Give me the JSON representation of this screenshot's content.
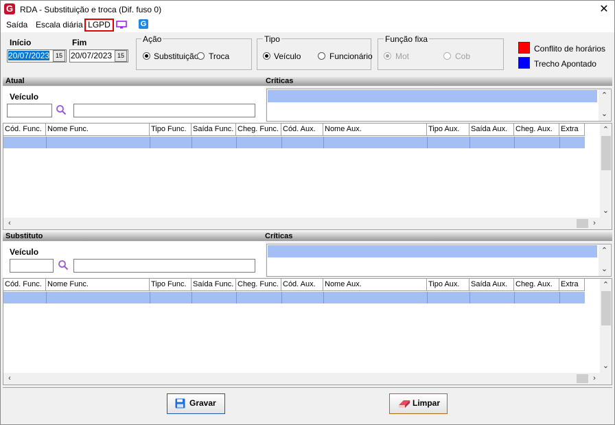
{
  "window": {
    "title": "RDA - Substituição e troca (Dif. fuso 0)"
  },
  "menu": {
    "saida": "Saída",
    "escala": "Escala diária",
    "lgpd": "LGPD"
  },
  "dates": {
    "inicio_label": "Início",
    "inicio_value": "20/07/2023",
    "fim_label": "Fim",
    "fim_value": "20/07/2023",
    "cal_glyph": "15"
  },
  "acao": {
    "title": "Ação",
    "opt1": "Substituição",
    "opt2": "Troca",
    "selected": "Substituição"
  },
  "tipo": {
    "title": "Tipo",
    "opt1": "Veículo",
    "opt2": "Funcionário",
    "selected": "Veículo"
  },
  "funcao": {
    "title": "Função fixa",
    "opt1": "Mot",
    "opt2": "Cob",
    "selected": "Mot"
  },
  "legend": {
    "conflito": "Conflito de horários",
    "conflito_color": "#ff0000",
    "trecho": "Trecho Apontado",
    "trecho_color": "#0000ff"
  },
  "atual": {
    "header": "Atual",
    "criticas": "Críticas",
    "veiculo_label": "Veículo"
  },
  "substituto": {
    "header": "Substituto",
    "criticas": "Críticas",
    "veiculo_label": "Veículo"
  },
  "columns": [
    "Cód. Func.",
    "Nome Func.",
    "Tipo Func.",
    "Saída Func.",
    "Cheg. Func.",
    "Cód. Aux.",
    "Nome Aux.",
    "Tipo Aux.",
    "Saída Aux.",
    "Cheg. Aux.",
    "Extra"
  ],
  "buttons": {
    "gravar": "Gravar",
    "limpar": "Limpar"
  },
  "colors": {
    "selection_row": "#a3bff3",
    "accent_blue": "#0078d7"
  }
}
